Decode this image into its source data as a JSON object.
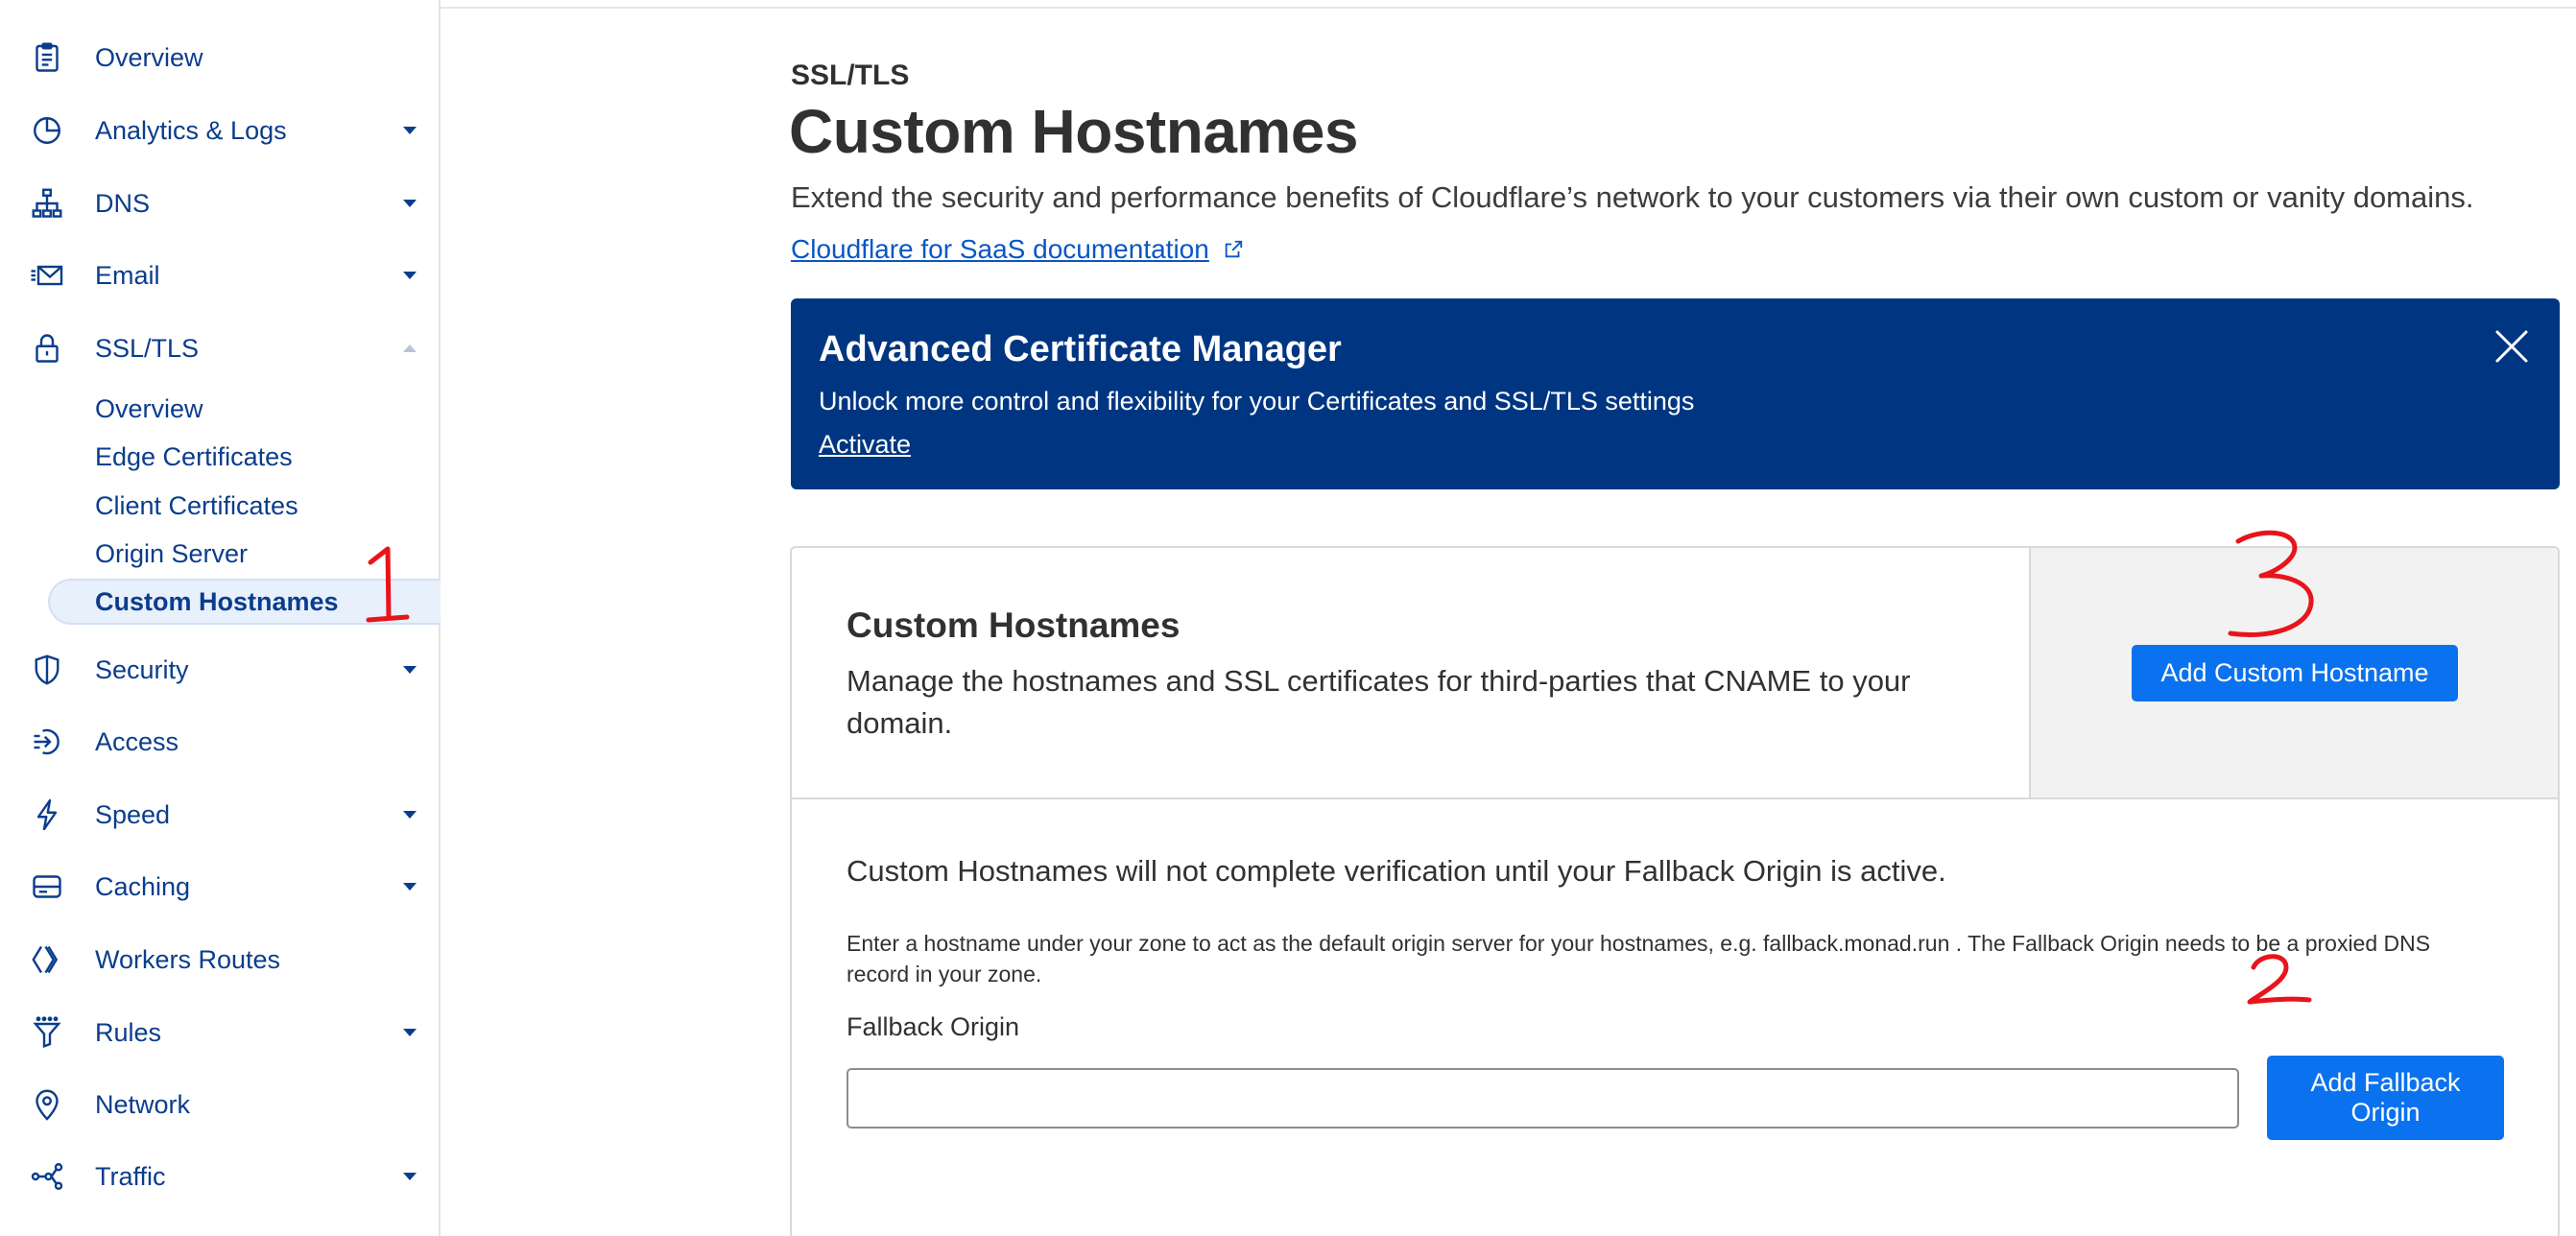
{
  "sidebar": {
    "items": [
      {
        "label": "Overview",
        "icon": "clipboard-icon",
        "caret": "none"
      },
      {
        "label": "Analytics & Logs",
        "icon": "pie-chart-icon",
        "caret": "down"
      },
      {
        "label": "DNS",
        "icon": "network-tree-icon",
        "caret": "down"
      },
      {
        "label": "Email",
        "icon": "envelope-icon",
        "caret": "down"
      },
      {
        "label": "SSL/TLS",
        "icon": "lock-icon",
        "caret": "up"
      },
      {
        "label": "Security",
        "icon": "shield-icon",
        "caret": "down"
      },
      {
        "label": "Access",
        "icon": "access-arrow-icon",
        "caret": "none"
      },
      {
        "label": "Speed",
        "icon": "lightning-icon",
        "caret": "down"
      },
      {
        "label": "Caching",
        "icon": "storage-icon",
        "caret": "down"
      },
      {
        "label": "Workers Routes",
        "icon": "workers-icon",
        "caret": "none"
      },
      {
        "label": "Rules",
        "icon": "funnel-icon",
        "caret": "down"
      },
      {
        "label": "Network",
        "icon": "location-pin-icon",
        "caret": "none"
      },
      {
        "label": "Traffic",
        "icon": "traffic-share-icon",
        "caret": "down"
      }
    ],
    "ssl_subitems": [
      {
        "label": "Overview",
        "active": false
      },
      {
        "label": "Edge Certificates",
        "active": false
      },
      {
        "label": "Client Certificates",
        "active": false
      },
      {
        "label": "Origin Server",
        "active": false
      },
      {
        "label": "Custom Hostnames",
        "active": true
      }
    ]
  },
  "header": {
    "section": "SSL/TLS",
    "title": "Custom Hostnames",
    "description": "Extend the security and performance benefits of Cloudflare’s network to your customers via their own custom or vanity domains.",
    "doc_link": "Cloudflare for SaaS documentation"
  },
  "banner": {
    "title": "Advanced Certificate Manager",
    "text": "Unlock more control and flexibility for your Certificates and SSL/TLS settings",
    "link": "Activate"
  },
  "card": {
    "title": "Custom Hostnames",
    "description": "Manage the hostnames and SSL certificates for third-parties that CNAME to your domain.",
    "add_button": "Add Custom Hostname",
    "warning": "Custom Hostnames will not complete verification until your Fallback Origin is active.",
    "help": "Enter a hostname under your zone to act as the default origin server for your hostnames, e.g. fallback.monad.run . The Fallback Origin needs to be a proxied DNS record in your zone.",
    "field_label": "Fallback Origin",
    "field_value": "",
    "fallback_button": "Add Fallback Origin"
  },
  "annotations": {
    "color": "#e8141c",
    "marks": [
      "1",
      "2",
      "3"
    ]
  },
  "colors": {
    "nav_text": "#0a3d8c",
    "banner_bg": "#003681",
    "primary_button": "#0a72ef",
    "link": "#0a56c4"
  }
}
